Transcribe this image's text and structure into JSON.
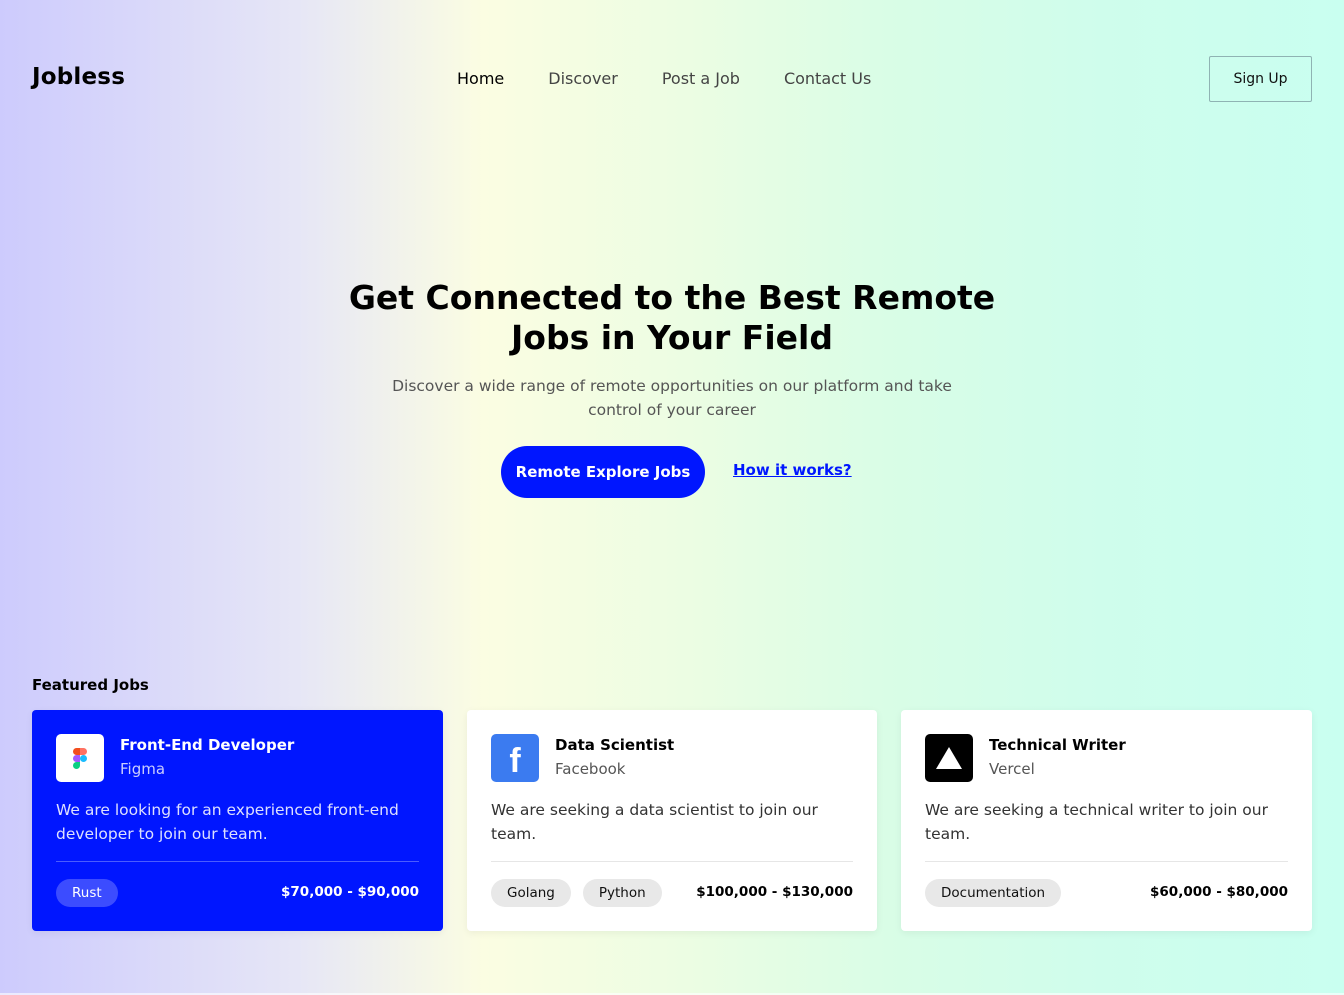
{
  "brand": {
    "name": "Jobless"
  },
  "nav": {
    "items": [
      {
        "label": "Home",
        "active": true
      },
      {
        "label": "Discover",
        "active": false
      },
      {
        "label": "Post a Job",
        "active": false
      },
      {
        "label": "Contact Us",
        "active": false
      }
    ],
    "signup_label": "Sign Up"
  },
  "hero": {
    "title": "Get Connected to the Best Remote Jobs in Your Field",
    "subtitle": "Discover a wide range of remote opportunities on our platform and take control of your career",
    "cta_label": "Remote Explore Jobs",
    "how_label": "How it works?"
  },
  "featured": {
    "heading": "Featured Jobs",
    "jobs": [
      {
        "title": "Front-End Developer",
        "company": "Figma",
        "icon": "figma-logo-icon",
        "description": "We are looking for an experienced front-end developer to join our team.",
        "tags": [
          "Rust"
        ],
        "salary": "$70,000 - $90,000"
      },
      {
        "title": "Data Scientist",
        "company": "Facebook",
        "icon": "facebook-logo-icon",
        "description": "We are seeking a data scientist to join our team.",
        "tags": [
          "Golang",
          "Python"
        ],
        "salary": "$100,000 - $130,000"
      },
      {
        "title": "Technical Writer",
        "company": "Vercel",
        "icon": "vercel-logo-icon",
        "description": "We are seeking a technical writer to join our team.",
        "tags": [
          "Documentation"
        ],
        "salary": "$60,000 - $80,000"
      }
    ]
  },
  "colors": {
    "accent": "#0016ff",
    "facebook": "#3b7bf0"
  }
}
